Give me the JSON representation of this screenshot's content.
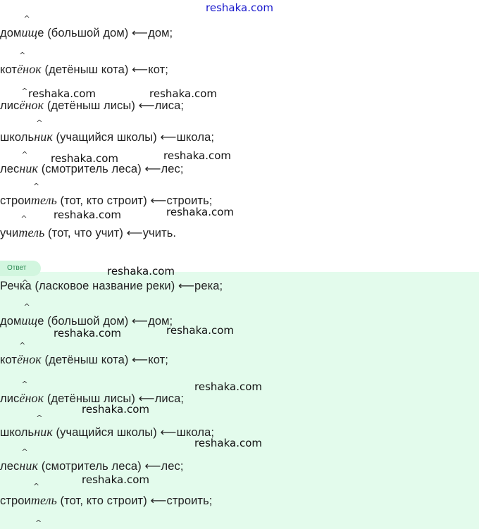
{
  "header": {
    "site": "reshaka.com"
  },
  "task": [
    {
      "base": "дом",
      "suffix": "ищ",
      "end": "е",
      "gloss": " (большой дом) ",
      "arrow": "⟵",
      "source": "дом;"
    },
    {
      "base": "кот",
      "suffix": "ёнок",
      "end": "",
      "gloss": " (детёныш кота) ",
      "arrow": "⟵",
      "source": "кот;"
    },
    {
      "base": "лис",
      "suffix": "ёнок",
      "end": "",
      "gloss": " (детёныш лисы) ",
      "arrow": "⟵",
      "source": "лиса;"
    },
    {
      "base": "школь",
      "suffix": "ник",
      "end": "",
      "gloss": " (учащийся школы) ",
      "arrow": "⟵",
      "source": "школа;"
    },
    {
      "base": "лес",
      "suffix": "ник",
      "end": "",
      "gloss": " (смотритель леса) ",
      "arrow": "⟵",
      "source": "лес;"
    },
    {
      "base": "строи",
      "suffix": "тель",
      "end": "",
      "gloss": " (тот, кто строит) ",
      "arrow": "⟵",
      "source": "строить;"
    },
    {
      "base": "учи",
      "suffix": "тель",
      "end": "",
      "gloss": " (тот, что учит) ",
      "arrow": "⟵",
      "source": "учить."
    }
  ],
  "answer": {
    "badge": "Ответ",
    "lines": [
      {
        "base": "Реч",
        "suffix": "",
        "end": "ка",
        "gloss": " (ласковое название реки) ",
        "arrow": "⟵",
        "source": "река;"
      },
      {
        "base": "дом",
        "suffix": "ищ",
        "end": "е",
        "gloss": " (большой дом) ",
        "arrow": "⟵",
        "source": "дом;"
      },
      {
        "base": "кот",
        "suffix": "ёнок",
        "end": "",
        "gloss": " (детёныш кота) ",
        "arrow": "⟵",
        "source": "кот;"
      },
      {
        "base": "лис",
        "suffix": "ёнок",
        "end": "",
        "gloss": " (детёныш лисы) ",
        "arrow": "⟵",
        "source": "лиса;"
      },
      {
        "base": "школь",
        "suffix": "ник",
        "end": "",
        "gloss": " (учащийся школы) ",
        "arrow": "⟵",
        "source": "школа;"
      },
      {
        "base": "лес",
        "suffix": "ник",
        "end": "",
        "gloss": " (смотритель леса) ",
        "arrow": "⟵",
        "source": "лес;"
      },
      {
        "base": "строи",
        "suffix": "тель",
        "end": "",
        "gloss": " (тот, кто строит) ",
        "arrow": "⟵",
        "source": "строить;"
      }
    ]
  },
  "watermark": {
    "text": "reshaka.com"
  },
  "marks": {
    "hat": "^"
  }
}
